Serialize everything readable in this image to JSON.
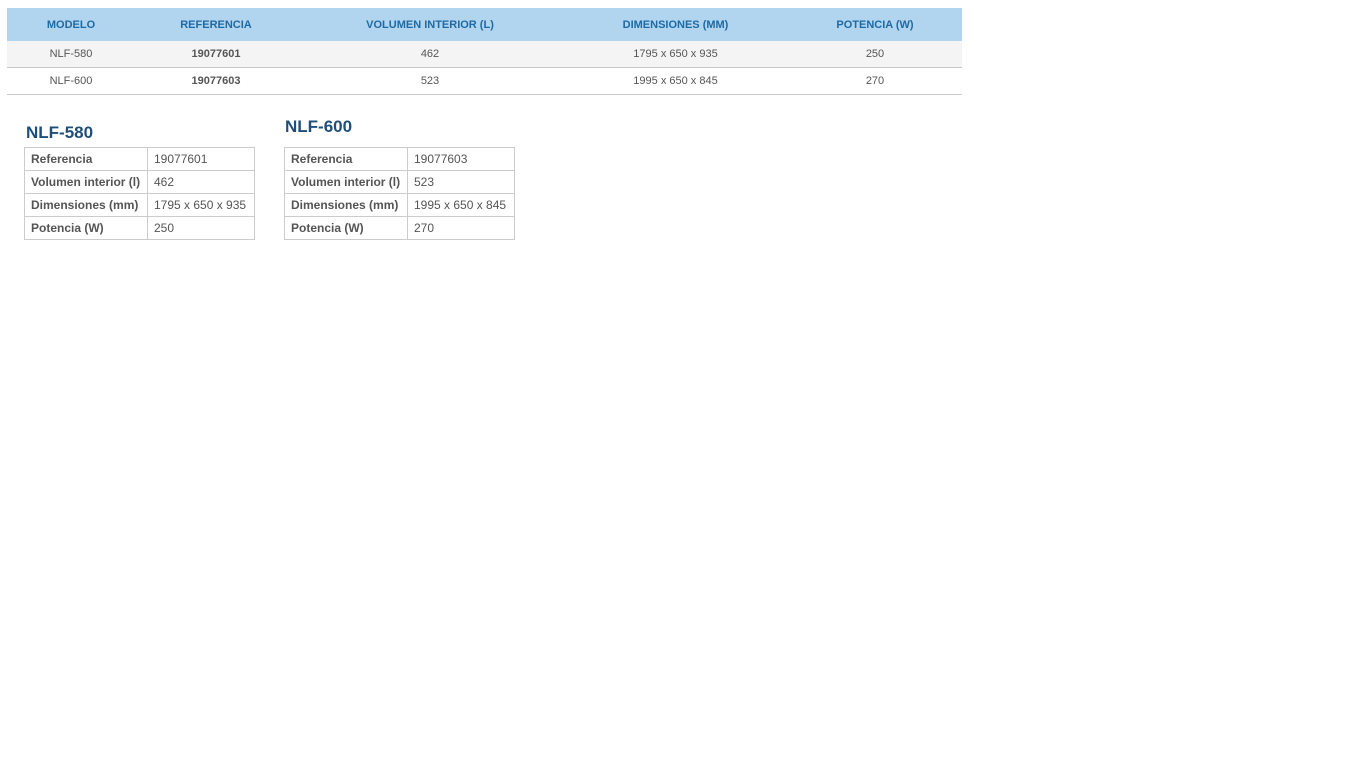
{
  "summary_table": {
    "headers": [
      "MODELO",
      "REFERENCIA",
      "VOLUMEN INTERIOR (L)",
      "DIMENSIONES (MM)",
      "POTENCIA (W)"
    ],
    "rows": [
      [
        "NLF-580",
        "19077601",
        "462",
        "1795 x 650 x 935",
        "250"
      ],
      [
        "NLF-600",
        "19077603",
        "523",
        "1995 x 650 x 845",
        "270"
      ]
    ]
  },
  "cards": [
    {
      "title": "NLF-580",
      "rows": [
        {
          "label": "Referencia",
          "value": "19077601"
        },
        {
          "label": "Volumen interior (l)",
          "value": "462"
        },
        {
          "label": "Dimensiones (mm)",
          "value": "1795 x 650 x 935"
        },
        {
          "label": "Potencia (W)",
          "value": "250"
        }
      ]
    },
    {
      "title": "NLF-600",
      "rows": [
        {
          "label": "Referencia",
          "value": "19077603"
        },
        {
          "label": "Volumen interior (l)",
          "value": "523"
        },
        {
          "label": "Dimensiones (mm)",
          "value": "1995 x 650 x 845"
        },
        {
          "label": "Potencia (W)",
          "value": "270"
        }
      ]
    }
  ]
}
